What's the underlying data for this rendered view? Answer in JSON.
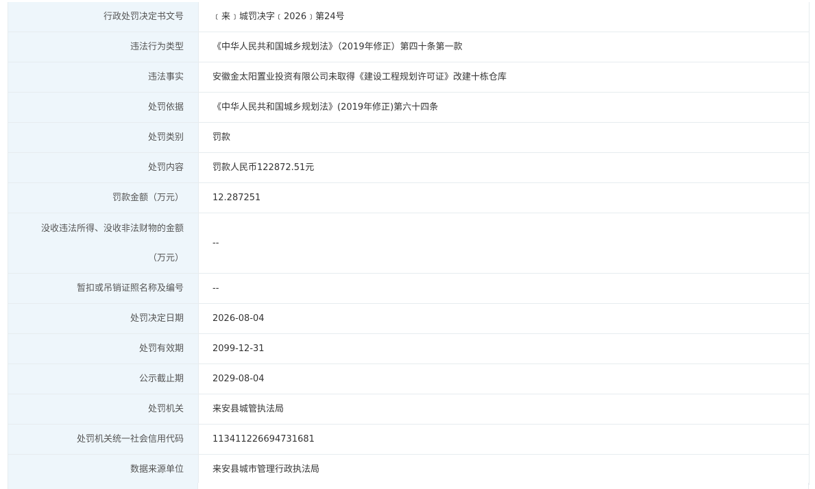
{
  "rows": [
    {
      "label": "行政处罚决定书文号",
      "value": "﹝来﹞城罚决字﹝2026﹞第24号"
    },
    {
      "label": "违法行为类型",
      "value": "《中华人民共和国城乡规划法》（2019年修正）第四十条第一款"
    },
    {
      "label": "违法事实",
      "value": "安徽金太阳置业投资有限公司未取得《建设工程规划许可证》改建十栋仓库"
    },
    {
      "label": "处罚依据",
      "value": "《中华人民共和国城乡规划法》(2019年修正)第六十四条"
    },
    {
      "label": "处罚类别",
      "value": "罚款"
    },
    {
      "label": "处罚内容",
      "value": "罚款人民币122872.51元"
    },
    {
      "label": "罚款金额（万元）",
      "value": "12.287251"
    },
    {
      "label_line1": "没收违法所得、没收非法财物的金额",
      "label_line2": "（万元）",
      "value": "--"
    },
    {
      "label": "暂扣或吊销证照名称及编号",
      "value": "--"
    },
    {
      "label": "处罚决定日期",
      "value": "2026-08-04"
    },
    {
      "label": "处罚有效期",
      "value": "2099-12-31"
    },
    {
      "label": "公示截止期",
      "value": "2029-08-04"
    },
    {
      "label": "处罚机关",
      "value": "来安县城管执法局"
    },
    {
      "label": "处罚机关统一社会信用代码",
      "value": "113411226694731681"
    },
    {
      "label": "数据来源单位",
      "value": "来安县城市管理行政执法局"
    }
  ]
}
